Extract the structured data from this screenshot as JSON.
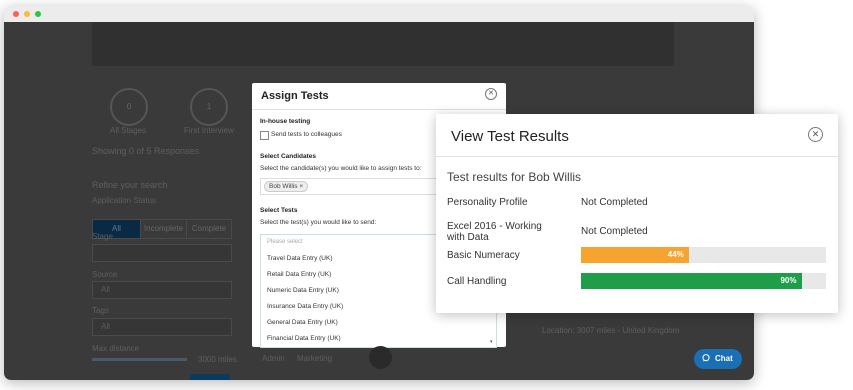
{
  "window": {
    "controls": [
      "close",
      "minimize",
      "maximize"
    ]
  },
  "background": {
    "stage_counts": [
      "0",
      "1"
    ],
    "stage_labels": [
      "All Stages",
      "First Interview"
    ],
    "showing": "Showing 0 of 5 Responses",
    "refine": "Refine your search",
    "application_status": "Application Status",
    "status_options": [
      "All",
      "Incomplete",
      "Complete"
    ],
    "stage_label": "Stage",
    "source_label": "Source",
    "source_value": "All",
    "tags_label": "Tags",
    "tags_value": "All",
    "max_distance": "Max distance",
    "distance_value": "3000 miles",
    "location_row": "Location: 3007 miles - United Kingdom",
    "tags_row": [
      "Admin",
      "Marketing"
    ]
  },
  "assign_tests": {
    "title": "Assign Tests",
    "close_icon": "close-circle-icon",
    "inhouse_heading": "In-house testing",
    "send_to_colleagues": "Send tests to colleagues",
    "select_candidates_heading": "Select Candidates",
    "select_candidates_help": "Select the candidate(s) you would like to assign tests to:",
    "candidate_tag": "Bob Willis ×",
    "select_tests_heading": "Select Tests",
    "select_tests_help": "Select the test(s) you would like to send:",
    "placeholder": "Please select",
    "test_options": [
      "Travel Data Entry (UK)",
      "Retail Data Entry (UK)",
      "Numeric Data Entry (UK)",
      "Insurance Data Entry (UK)",
      "General Data Entry (UK)",
      "Financial Data Entry (UK)"
    ]
  },
  "view_results": {
    "title": "View Test Results",
    "subtitle": "Test results for Bob Willis",
    "rows": [
      {
        "label": "Personality Profile",
        "status": "Not Completed"
      },
      {
        "label": "Excel 2016 - Working with Data",
        "status": "Not Completed"
      },
      {
        "label": "Basic Numeracy",
        "percent_text": "44%",
        "progress": 0.44,
        "color": "#f7a330"
      },
      {
        "label": "Call Handling",
        "percent_text": "90%",
        "progress": 0.9,
        "color": "#1e9e48"
      }
    ]
  },
  "chat": {
    "label": "Chat",
    "icon": "chat-bubble-icon",
    "color": "#1a6fb5"
  }
}
